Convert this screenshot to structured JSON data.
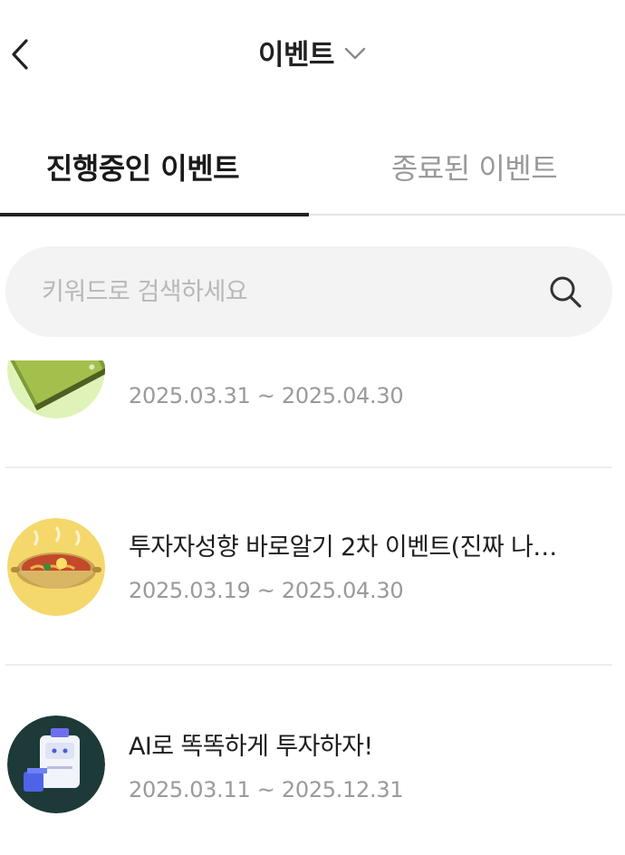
{
  "header": {
    "title": "이벤트"
  },
  "tabs": [
    {
      "label": "진행중인 이벤트",
      "active": true
    },
    {
      "label": "종료된 이벤트",
      "active": false
    }
  ],
  "search": {
    "placeholder": "키워드로 검색하세요",
    "value": ""
  },
  "events": [
    {
      "title": "",
      "period": "2025.03.31 ~ 2025.04.30",
      "thumb": "green-notebook"
    },
    {
      "title": "투자자성향 바로알기 2차 이벤트(진짜 나…",
      "period": "2025.03.19 ~ 2025.04.30",
      "thumb": "ramen-pot"
    },
    {
      "title": "AI로 똑똑하게 투자하자!",
      "period": "2025.03.11 ~ 2025.12.31",
      "thumb": "ai-box"
    }
  ],
  "colors": {
    "accent": "#222222",
    "inactive_tab": "#9a9a9a",
    "search_bg": "#f3f3f3",
    "date": "#9a9a9a"
  }
}
